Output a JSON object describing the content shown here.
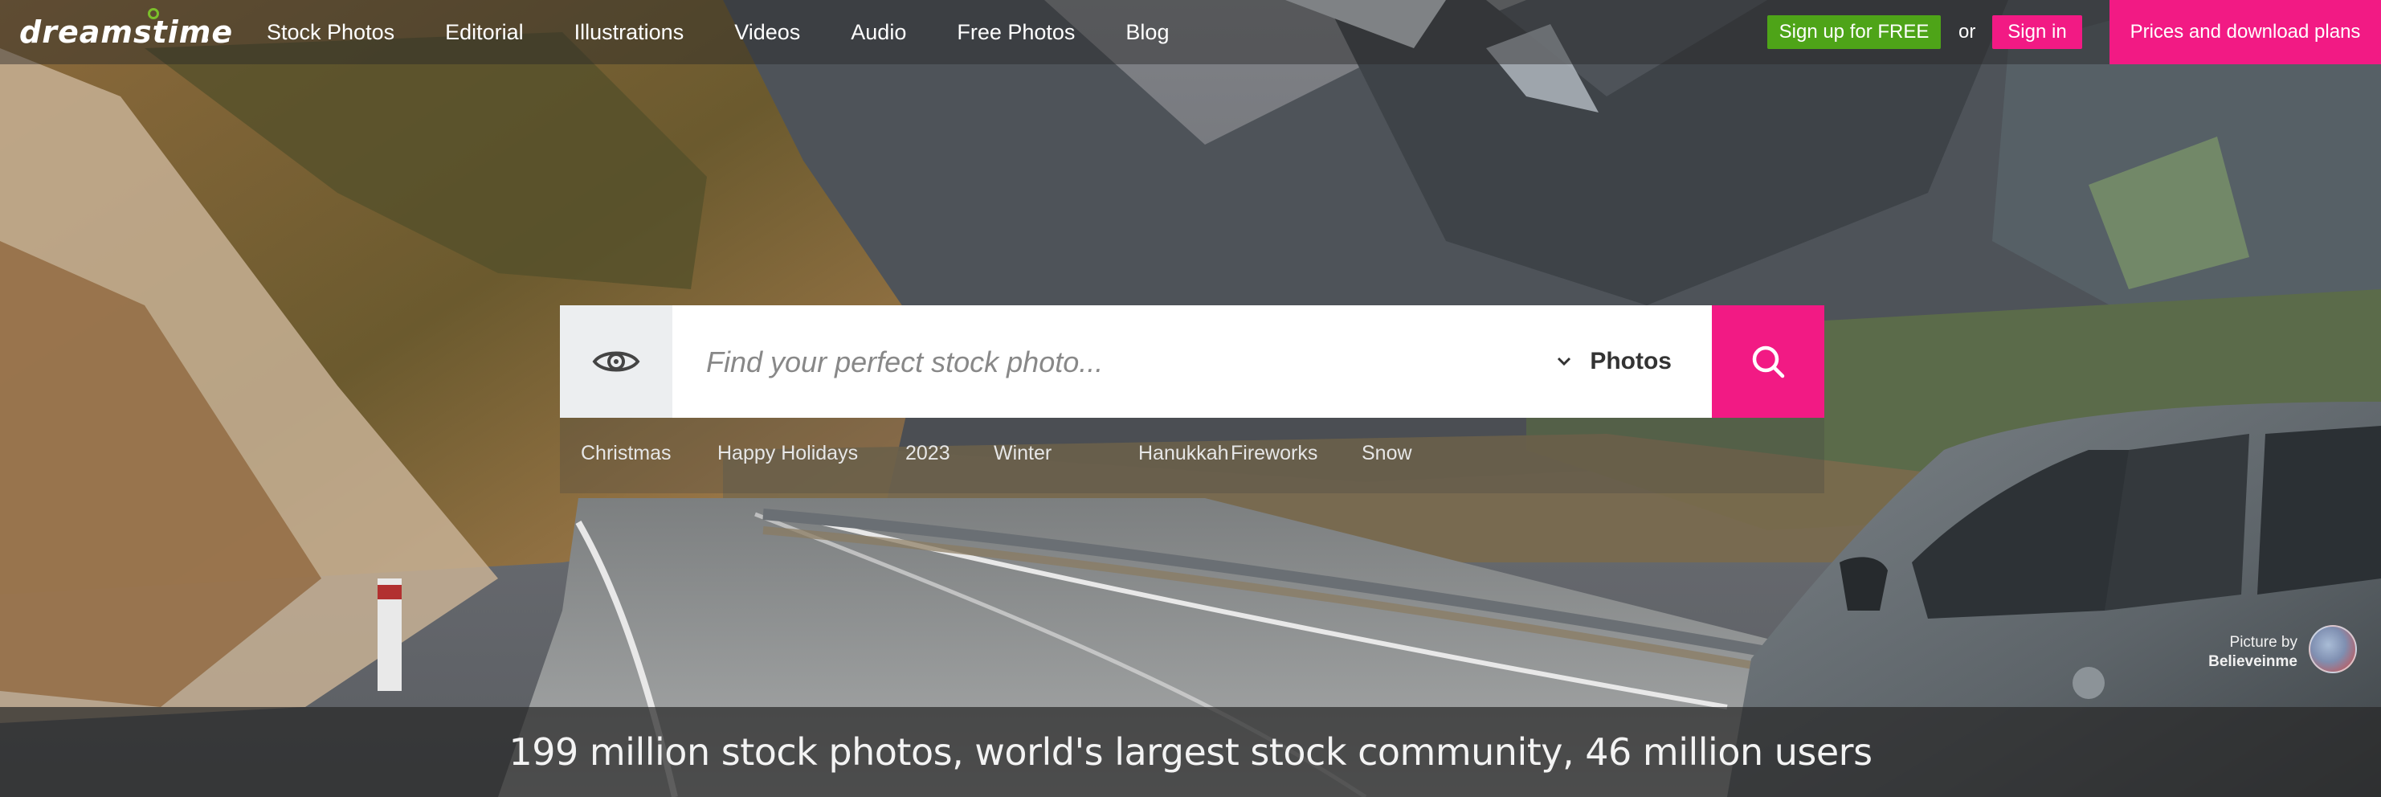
{
  "header": {
    "logo_text": "dreamstime",
    "nav": [
      "Stock Photos",
      "Editorial",
      "Illustrations",
      "Videos",
      "Audio",
      "Free Photos",
      "Blog"
    ],
    "signup_label": "Sign up for FREE",
    "or_label": "or",
    "signin_label": "Sign in",
    "prices_label": "Prices and download plans"
  },
  "search": {
    "placeholder": "Find your perfect stock photo...",
    "type_selected": "Photos",
    "eye_icon": "eye-icon",
    "search_icon": "magnifier-icon",
    "dropdown_icon": "chevron-down-icon"
  },
  "tags": [
    "Christmas",
    "Happy Holidays",
    "2023",
    "Winter",
    "Hanukkah",
    "Fireworks",
    "Snow"
  ],
  "credit": {
    "line1": "Picture by",
    "line2": "Believeinme"
  },
  "banner": {
    "text": "199 million stock photos, world's largest stock community, 46 million users"
  },
  "colors": {
    "brand_pink": "#f21a84",
    "signup_green": "#4ea418",
    "logo_green": "#7bbf2a"
  }
}
